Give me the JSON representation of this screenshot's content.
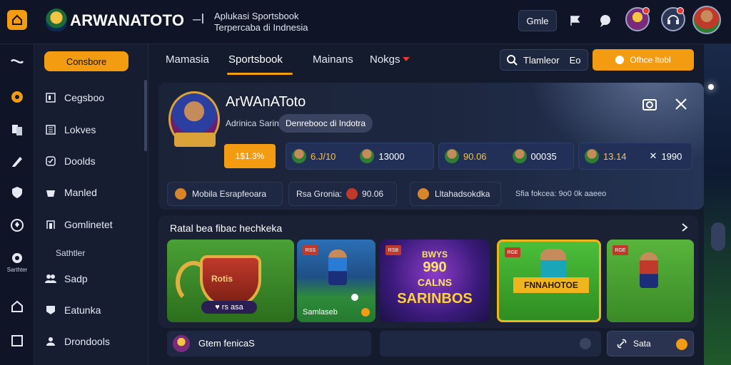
{
  "header": {
    "brand_name": "ARWANATOTO",
    "brand_sep": "–I",
    "tagline": "Aplukasi Sportsbook Terpercaba di Indnesia",
    "chip_label": "Gmle"
  },
  "rail": {
    "label": "Sarthter"
  },
  "sidebar": {
    "cta_label": "Consbore",
    "items": [
      {
        "label": "Cegsboo"
      },
      {
        "label": "Lokves"
      },
      {
        "label": "Doolds"
      },
      {
        "label": "Manled"
      },
      {
        "label": "Gomlinetet"
      },
      {
        "label": "Sadp"
      },
      {
        "label": "Eatunka"
      },
      {
        "label": "Drondools"
      }
    ],
    "sub_label": "Sathtler"
  },
  "nav": {
    "tabs": [
      {
        "label": "Mamasia"
      },
      {
        "label": "Sportsbook"
      },
      {
        "label": "Mainans"
      },
      {
        "label": "Nokgs"
      }
    ],
    "search_value": "Tlamleor",
    "search_suffix": "Eo",
    "promo_label": "Ofhce ltobl"
  },
  "profile": {
    "name": "ArWAnAToto",
    "subtitle": "Adrinica Sarin",
    "pill_label": "Denrebooc di Indotra",
    "stat_primary": "1$1.3%",
    "stats": [
      {
        "a": "6.J/10",
        "b": "13000"
      },
      {
        "a": "90.06",
        "b": "00035"
      },
      {
        "a": "13.14",
        "b": "1990"
      }
    ]
  },
  "info": {
    "chip1": "Mobila Esrapfeoara",
    "chip2_label": "Rsa Gronia:",
    "chip2_value": "90.06",
    "chip3": "Lltahadsokdka",
    "trailing_text": "Sfia fokcea: 9o0 0k aaeeo"
  },
  "games": {
    "section_title": "Ratal bea fibac hechkeka",
    "cards": [
      {
        "caption": "",
        "shield_text": "Rotis",
        "shield_tag": "♥ rs asa"
      },
      {
        "tag": "RSS",
        "caption": "Samlaseb"
      },
      {
        "tag": "RSB",
        "title_top": "BWYS",
        "title_big": "990",
        "title_mid": "CALNS",
        "title_bottom": "SARINBOS"
      },
      {
        "tag": "RGE",
        "title": "FNNAHOTOE"
      },
      {
        "tag": "RGE",
        "caption": ""
      }
    ]
  },
  "bottom": {
    "label": "Gtem fenicaS",
    "right_label": "Sata"
  },
  "colors": {
    "accent": "#f39c12",
    "background": "#141b2d",
    "panel": "#1b2338"
  }
}
